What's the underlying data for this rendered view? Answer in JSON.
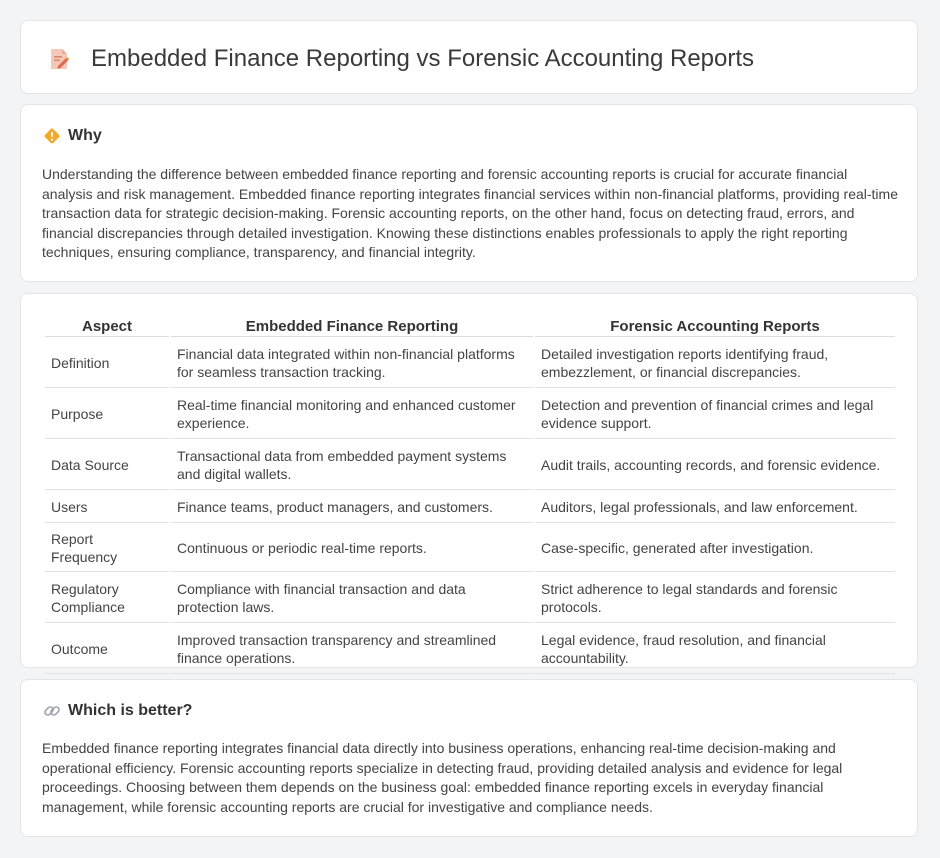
{
  "header": {
    "title": "Embedded Finance Reporting vs Forensic Accounting Reports",
    "icon": "document-edit-icon"
  },
  "why": {
    "heading": "Why",
    "icon": "diamond-warning-icon",
    "text": "Understanding the difference between embedded finance reporting and forensic accounting reports is crucial for accurate financial analysis and risk management. Embedded finance reporting integrates financial services within non-financial platforms, providing real-time transaction data for strategic decision-making. Forensic accounting reports, on the other hand, focus on detecting fraud, errors, and financial discrepancies through detailed investigation. Knowing these distinctions enables professionals to apply the right reporting techniques, ensuring compliance, transparency, and financial integrity."
  },
  "table": {
    "headers": [
      "Aspect",
      "Embedded Finance Reporting",
      "Forensic Accounting Reports"
    ],
    "rows": [
      {
        "aspect": "Definition",
        "embedded": "Financial data integrated within non-financial platforms for seamless transaction tracking.",
        "forensic": "Detailed investigation reports identifying fraud, embezzlement, or financial discrepancies."
      },
      {
        "aspect": "Purpose",
        "embedded": "Real-time financial monitoring and enhanced customer experience.",
        "forensic": "Detection and prevention of financial crimes and legal evidence support."
      },
      {
        "aspect": "Data Source",
        "embedded": "Transactional data from embedded payment systems and digital wallets.",
        "forensic": "Audit trails, accounting records, and forensic evidence."
      },
      {
        "aspect": "Users",
        "embedded": "Finance teams, product managers, and customers.",
        "forensic": "Auditors, legal professionals, and law enforcement."
      },
      {
        "aspect": "Report Frequency",
        "embedded": "Continuous or periodic real-time reports.",
        "forensic": "Case-specific, generated after investigation."
      },
      {
        "aspect": "Regulatory Compliance",
        "embedded": "Compliance with financial transaction and data protection laws.",
        "forensic": "Strict adherence to legal standards and forensic protocols."
      },
      {
        "aspect": "Outcome",
        "embedded": "Improved transaction transparency and streamlined finance operations.",
        "forensic": "Legal evidence, fraud resolution, and financial accountability."
      }
    ]
  },
  "better": {
    "heading": "Which is better?",
    "icon": "link-icon",
    "text": "Embedded finance reporting integrates financial data directly into business operations, enhancing real-time decision-making and operational efficiency. Forensic accounting reports specialize in detecting fraud, providing detailed analysis and evidence for legal proceedings. Choosing between them depends on the business goal: embedded finance reporting excels in everyday financial management, while forensic accounting reports are crucial for investigative and compliance needs."
  }
}
